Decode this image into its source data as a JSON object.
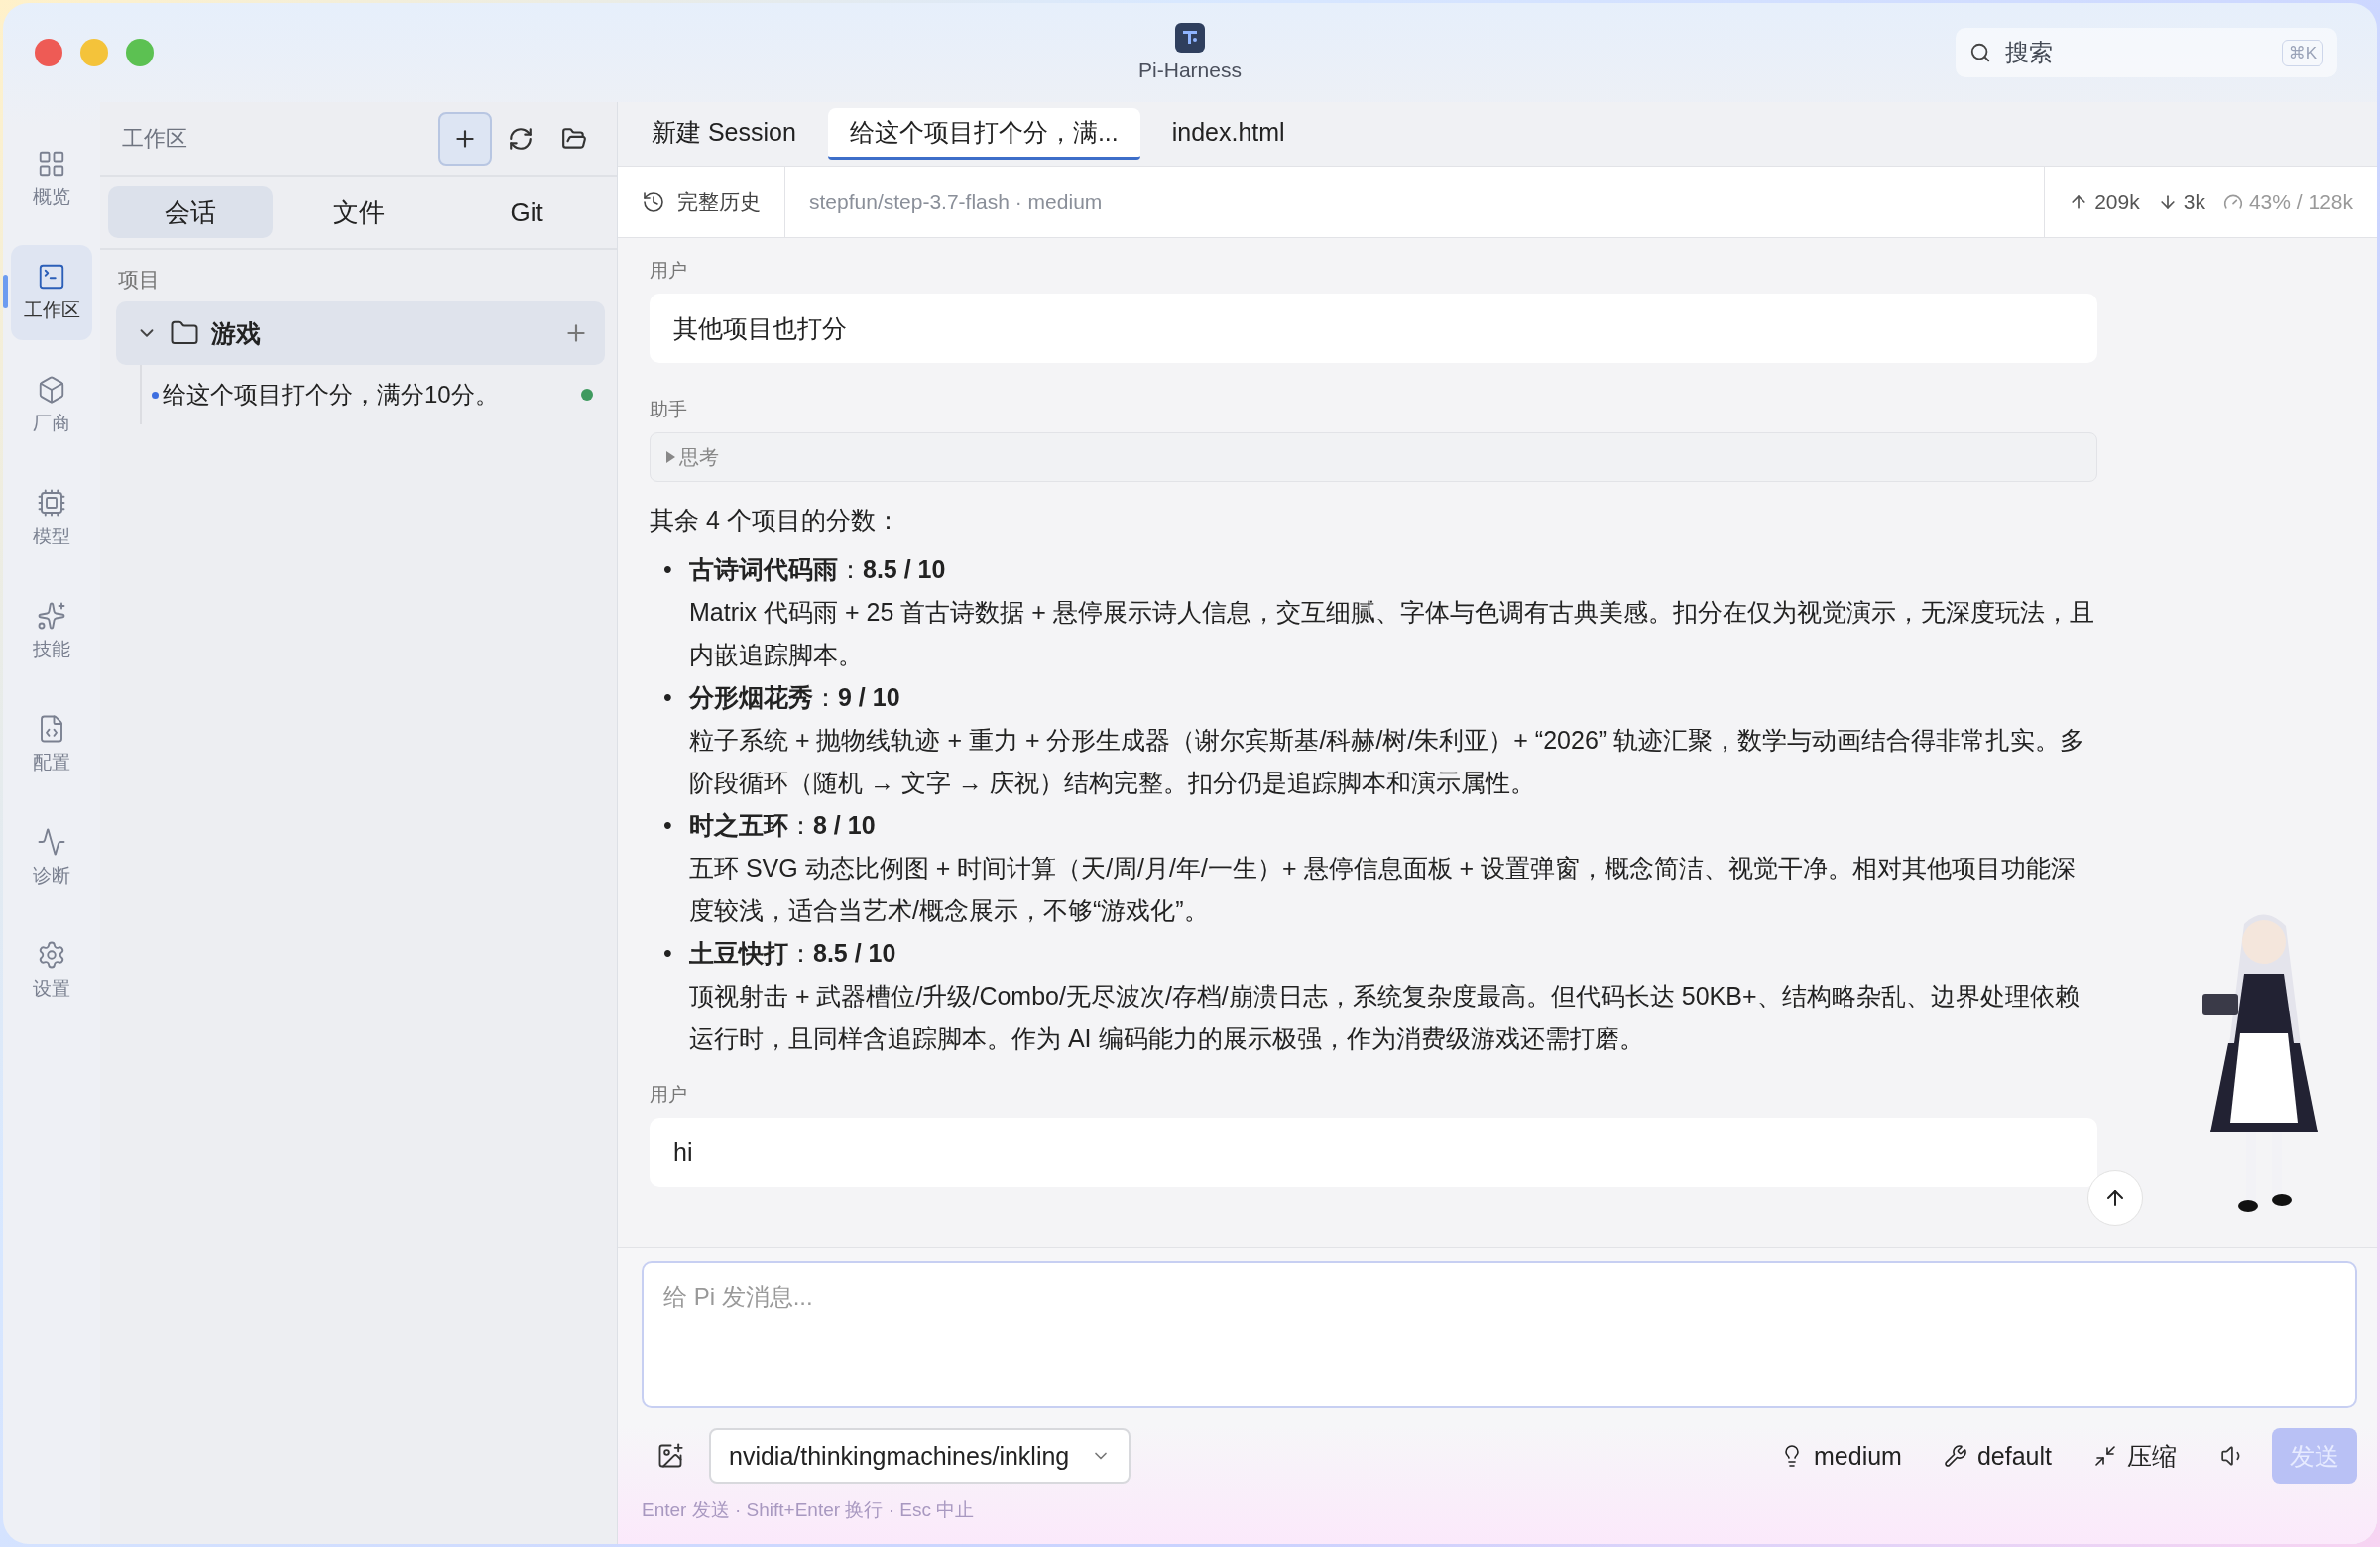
{
  "window": {
    "title": "Pi-Harness"
  },
  "search": {
    "placeholder": "搜索",
    "shortcut": "⌘K"
  },
  "nav": [
    {
      "label": "概览",
      "selected": false
    },
    {
      "label": "工作区",
      "selected": true
    },
    {
      "label": "厂商",
      "selected": false
    },
    {
      "label": "模型",
      "selected": false
    },
    {
      "label": "技能",
      "selected": false
    },
    {
      "label": "配置",
      "selected": false
    },
    {
      "label": "诊断",
      "selected": false
    },
    {
      "label": "设置",
      "selected": false
    }
  ],
  "workspace": {
    "title": "工作区",
    "tabs": [
      {
        "label": "会话",
        "selected": true
      },
      {
        "label": "文件",
        "selected": false
      },
      {
        "label": "Git",
        "selected": false
      }
    ],
    "section": "项目",
    "projects": [
      {
        "name": "游戏",
        "expanded": true,
        "children": [
          {
            "title": "给这个项目打个分，满分10分。",
            "selected": true,
            "active": true
          }
        ]
      }
    ]
  },
  "editor_tabs": [
    {
      "label": "新建 Session",
      "selected": false
    },
    {
      "label": "给这个项目打个分，满...",
      "selected": true
    },
    {
      "label": "index.html",
      "selected": false
    }
  ],
  "info_bar": {
    "history": "完整历史",
    "model": "stepfun/step-3.7-flash · medium",
    "tokens_up": "209k",
    "tokens_down": "3k",
    "context": "43% / 128k"
  },
  "messages": [
    {
      "kind": "user",
      "role": "用户",
      "text": "其他项目也打分"
    },
    {
      "kind": "assistant",
      "role": "助手",
      "thinking": {
        "label": "思考",
        "expanded": false
      },
      "intro": "其余 4 个项目的分数：",
      "items": [
        {
          "marker": "•",
          "heading": "**古诗词代码雨**：**8.5 / 10**",
          "body": "Matrix 代码雨 + 25 首古诗数据 + 悬停展示诗人信息，交互细腻、字体与色调有古典美感。扣分在仅为视觉演示，无深度玩法，且内嵌追踪脚本。"
        },
        {
          "marker": "•",
          "heading": "**分形烟花秀**：**9 / 10**",
          "body": "粒子系统 + 抛物线轨迹 + 重力 + 分形生成器（谢尔宾斯基/科赫/树/朱利亚）+ “2026” 轨迹汇聚，数学与动画结合得非常扎实。多阶段循环（随机 → 文字 → 庆祝）结构完整。扣分仍是追踪脚本和演示属性。"
        },
        {
          "marker": "•",
          "heading": "**时之五环**：**8 / 10**",
          "body": "五环 SVG 动态比例图 + 时间计算（天/周/月/年/一生）+ 悬停信息面板 + 设置弹窗，概念简洁、视觉干净。相对其他项目功能深度较浅，适合当艺术/概念展示，不够“游戏化”。"
        },
        {
          "marker": "•",
          "heading": "**土豆快打**：**8.5 / 10**",
          "body": "顶视射击 + 武器槽位/升级/Combo/无尽波次/存档/崩溃日志，系统复杂度最高。但代码长达 50KB+、结构略杂乱、边界处理依赖运行时，且同样含追踪脚本。作为 AI 编码能力的展示极强，作为消费级游戏还需打磨。"
        }
      ]
    },
    {
      "kind": "user",
      "role": "用户",
      "text": "hi"
    }
  ],
  "composer": {
    "placeholder": "给 Pi 发消息...",
    "model": "nvidia/thinkingmachines/inkling",
    "effort": "medium",
    "tool": "default",
    "compress": "压缩",
    "send": "发送",
    "send_disabled": true,
    "hint": "Enter 发送 · Shift+Enter 换行 · Esc 中止"
  }
}
